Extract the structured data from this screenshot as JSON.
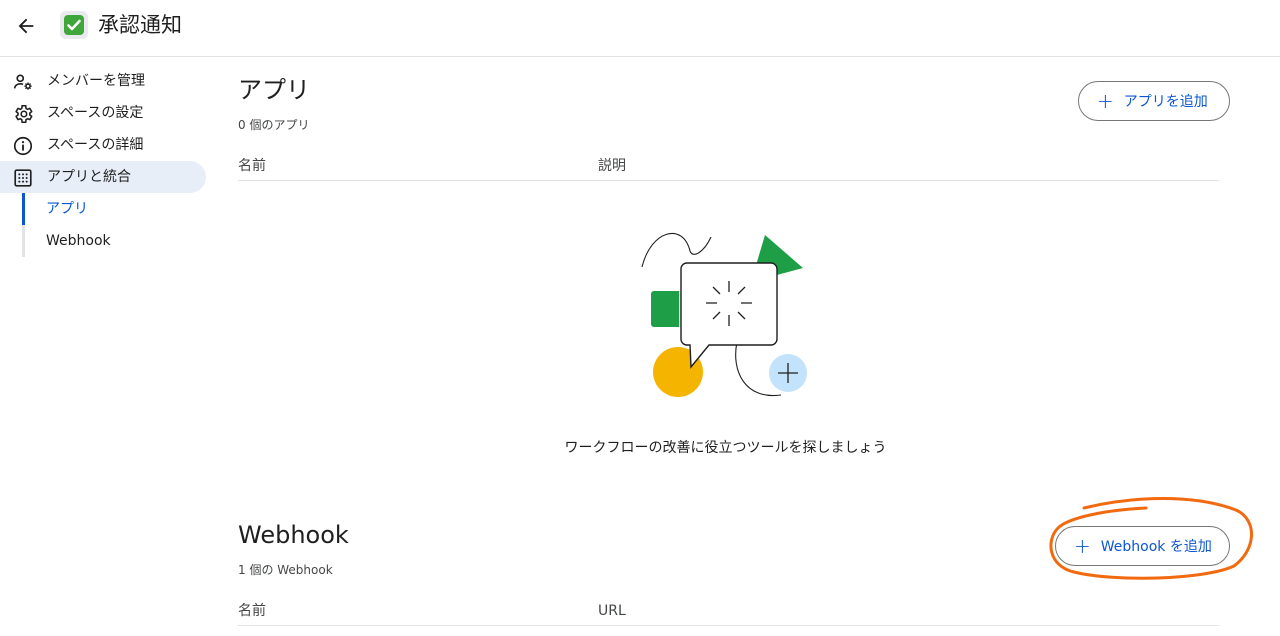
{
  "header": {
    "back_icon": "arrow-left-icon",
    "space_emoji": "✅",
    "space_name": "承認通知"
  },
  "sidebar": {
    "items": [
      {
        "label": "メンバーを管理",
        "icon": "manage-members-icon"
      },
      {
        "label": "スペースの設定",
        "icon": "gear-icon"
      },
      {
        "label": "スペースの詳細",
        "icon": "info-icon"
      },
      {
        "label": "アプリと統合",
        "icon": "apps-grid-icon",
        "active": true
      }
    ],
    "subitems": [
      {
        "label": "アプリ",
        "selected": true
      },
      {
        "label": "Webhook",
        "selected": false
      }
    ]
  },
  "apps_section": {
    "title": "アプリ",
    "count": "0 個のアプリ",
    "add_button": "アプリを追加",
    "columns": [
      "名前",
      "説明"
    ],
    "empty_message": "ワークフローの改善に役立つツールを探しましょう"
  },
  "webhook_section": {
    "title": "Webhook",
    "count": "1 個の Webhook",
    "add_button": "Webhook を追加",
    "columns": [
      "名前",
      "URL"
    ]
  },
  "colors": {
    "accent": "#0b57d0",
    "active_nav_bg": "#e8eef8",
    "annotation": "#f26a10"
  }
}
